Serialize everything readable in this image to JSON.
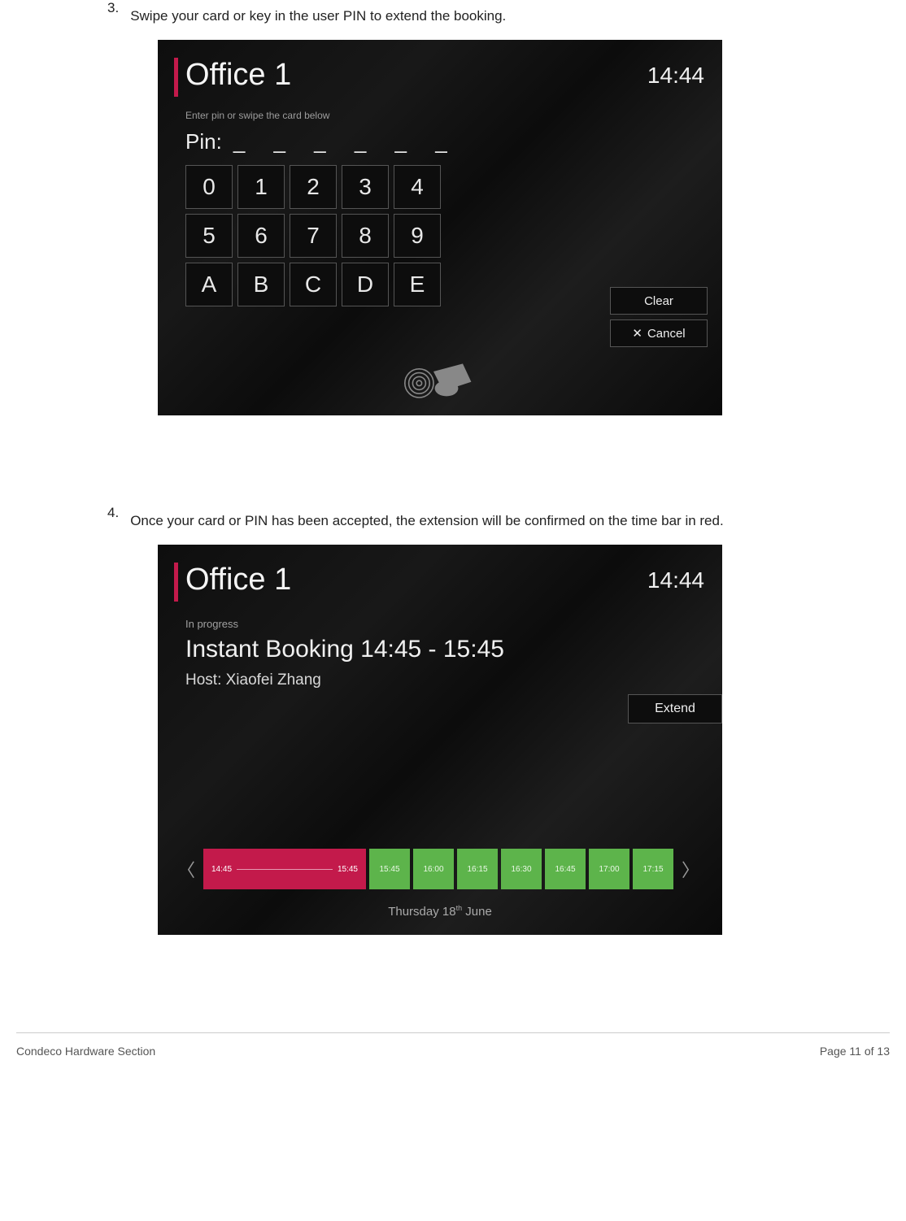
{
  "steps": {
    "s3": {
      "num": "3.",
      "text": "Swipe your card or key in the user PIN to extend the booking."
    },
    "s4": {
      "num": "4.",
      "text": " Once your card or PIN has been accepted, the extension will be confirmed on the time bar in red."
    }
  },
  "screen1": {
    "room": "Office 1",
    "clock": "14:44",
    "hint": "Enter pin or swipe the card below",
    "pin_label": "Pin:",
    "pin_placeholder": "_ _ _ _ _ _",
    "keys": [
      "0",
      "1",
      "2",
      "3",
      "4",
      "5",
      "6",
      "7",
      "8",
      "9",
      "A",
      "B",
      "C",
      "D",
      "E"
    ],
    "clear": "Clear",
    "cancel": "Cancel"
  },
  "screen2": {
    "room": "Office 1",
    "clock": "14:44",
    "status": "In progress",
    "booking_title": "Instant Booking 14:45 - 15:45",
    "host": "Host: Xiaofei Zhang",
    "extend": "Extend",
    "booked_start": "14:45",
    "booked_end": "15:45",
    "free_slots": [
      "15:45",
      "16:00",
      "16:15",
      "16:30",
      "16:45",
      "17:00",
      "17:15"
    ],
    "date_prefix": "Thursday 18",
    "date_suffix": " June",
    "date_ord": "th"
  },
  "footer": {
    "left": "Condeco Hardware Section",
    "right": "Page 11 of 13"
  }
}
